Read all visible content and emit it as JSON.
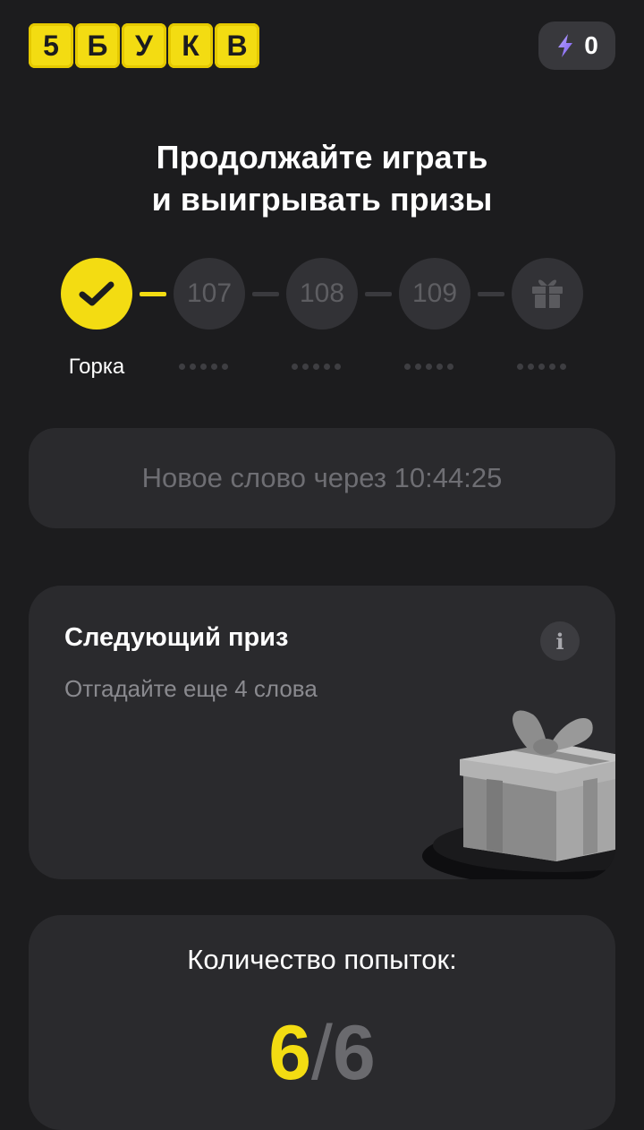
{
  "header": {
    "logo_letters": [
      "5",
      "Б",
      "У",
      "К",
      "В"
    ],
    "energy": {
      "icon": "lightning-icon",
      "count": "0"
    }
  },
  "headline": {
    "line1": "Продолжайте играть",
    "line2": "и выигрывать призы"
  },
  "progress": {
    "steps": [
      {
        "label": "Горка",
        "status": "done",
        "icon": "check-icon"
      },
      {
        "number": "107",
        "status": "locked"
      },
      {
        "number": "108",
        "status": "locked"
      },
      {
        "number": "109",
        "status": "locked"
      },
      {
        "status": "locked",
        "icon": "gift-icon"
      }
    ]
  },
  "timer": {
    "text": "Новое слово через 10:44:25"
  },
  "prize": {
    "title": "Следующий приз",
    "subtitle": "Отгадайте еще 4 слова",
    "info_icon": "i"
  },
  "attempts": {
    "title": "Количество попыток:",
    "current": "6",
    "separator": "/",
    "max": "6"
  },
  "colors": {
    "background": "#1c1c1e",
    "card": "#2a2a2d",
    "accent": "#f3dc12",
    "muted": "#6e6e73"
  }
}
